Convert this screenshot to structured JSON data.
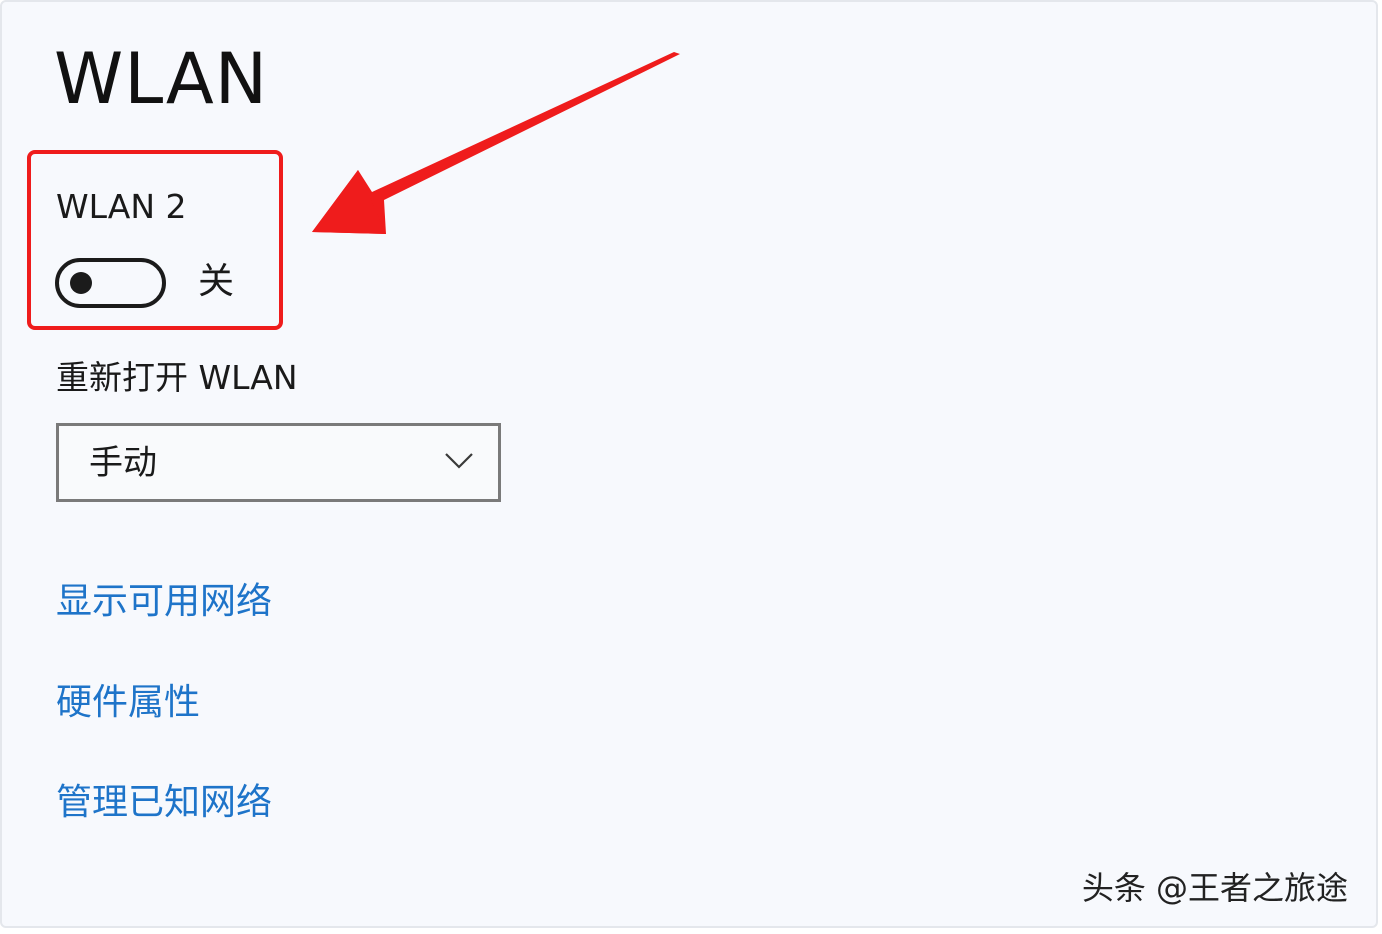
{
  "header": {
    "title": "WLAN"
  },
  "adapter": {
    "name": "WLAN 2",
    "toggle_state_label": "关",
    "enabled": false
  },
  "reenable": {
    "label": "重新打开 WLAN",
    "selected_value": "手动"
  },
  "links": [
    {
      "label": "显示可用网络"
    },
    {
      "label": "硬件属性"
    },
    {
      "label": "管理已知网络"
    }
  ],
  "watermark": {
    "text": "头条 @王者之旅途"
  },
  "colors": {
    "highlight": "#ef1c1c",
    "link": "#1e74c9",
    "background": "#f7f9fd"
  }
}
